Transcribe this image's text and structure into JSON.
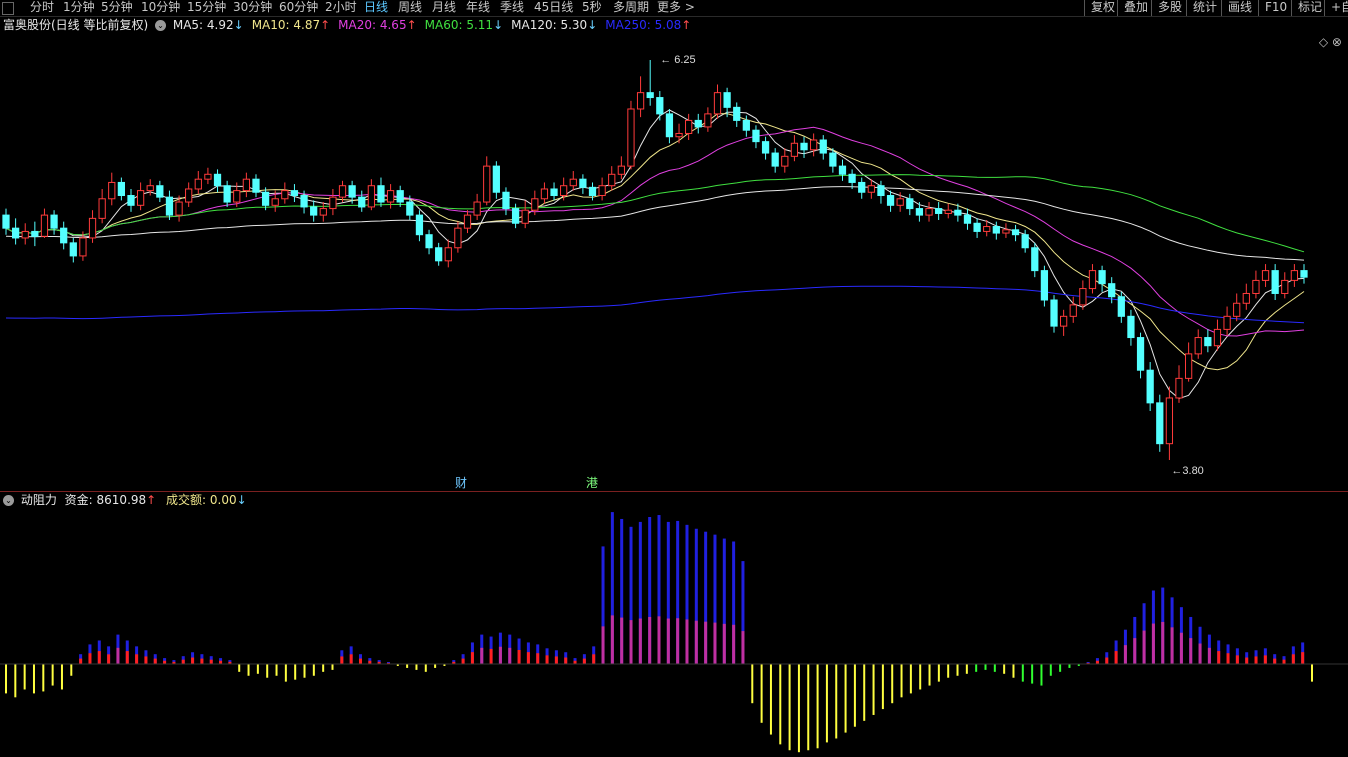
{
  "toolbar": {
    "tabs": [
      "分时",
      "1分钟",
      "5分钟",
      "10分钟",
      "15分钟",
      "30分钟",
      "60分钟",
      "2小时",
      "日线",
      "周线",
      "月线",
      "年线",
      "季线",
      "45日线",
      "5秒",
      "多周期",
      "更多 >"
    ],
    "active_tab": "日线",
    "right_tabs": [
      "复权",
      "叠加",
      "多股",
      "统计",
      "画线",
      "F10",
      "标记",
      "+自"
    ]
  },
  "info": {
    "stock": "富奥股份(日线 等比前复权)",
    "ma": [
      {
        "label": "MA5: 4.92",
        "arrow": "↓",
        "color": "#e6e6e6"
      },
      {
        "label": "MA10: 4.87",
        "arrow": "↑",
        "color": "#f0e68c"
      },
      {
        "label": "MA20: 4.65",
        "arrow": "↑",
        "color": "#e040e0"
      },
      {
        "label": "MA60: 5.11",
        "arrow": "↓",
        "color": "#40e040"
      },
      {
        "label": "MA120: 5.30",
        "arrow": "↓",
        "color": "#e6e6e6"
      },
      {
        "label": "MA250: 5.08",
        "arrow": "↑",
        "color": "#2a2aff"
      }
    ],
    "right_icons": "◇ ⊗"
  },
  "annotations": {
    "high": "6.25",
    "low": "3.80",
    "event_cai": "财",
    "event_gang": "港"
  },
  "sub_info": {
    "name": "动阻力",
    "fund_label": "资金: 8610.98",
    "fund_arrow": "↑",
    "volume_label": "成交额: 0.00",
    "volume_arrow": "↓"
  },
  "colors": {
    "up": "#ff3b3b",
    "down": "#54ffff",
    "ma5": "#e6e6e6",
    "ma10": "#f0e68c",
    "ma20": "#e040e0",
    "ma60": "#40e040",
    "ma120": "#e6e6e6",
    "ma250": "#2a2aff",
    "pos_fund": "#2020e0",
    "pos_red": "#ff2020",
    "pos_purple": "#c030a0",
    "neg_yellow": "#ffff40",
    "neg_green": "#30ff30"
  },
  "chart_data": {
    "type": "candlestick",
    "title": "富奥股份(日线 等比前复权)",
    "price_range": [
      3.8,
      6.25
    ],
    "candles": [
      [
        5.3,
        5.22,
        5.34,
        5.18
      ],
      [
        5.22,
        5.16,
        5.28,
        5.12
      ],
      [
        5.16,
        5.2,
        5.25,
        5.12
      ],
      [
        5.2,
        5.17,
        5.26,
        5.11
      ],
      [
        5.17,
        5.3,
        5.34,
        5.16
      ],
      [
        5.3,
        5.22,
        5.33,
        5.18
      ],
      [
        5.22,
        5.13,
        5.26,
        5.09
      ],
      [
        5.13,
        5.05,
        5.16,
        5.01
      ],
      [
        5.05,
        5.16,
        5.2,
        5.02
      ],
      [
        5.16,
        5.28,
        5.33,
        5.13
      ],
      [
        5.28,
        5.4,
        5.46,
        5.25
      ],
      [
        5.4,
        5.5,
        5.56,
        5.36
      ],
      [
        5.5,
        5.42,
        5.53,
        5.39
      ],
      [
        5.42,
        5.36,
        5.46,
        5.32
      ],
      [
        5.36,
        5.45,
        5.5,
        5.33
      ],
      [
        5.45,
        5.48,
        5.52,
        5.42
      ],
      [
        5.48,
        5.41,
        5.51,
        5.38
      ],
      [
        5.41,
        5.3,
        5.45,
        5.27
      ],
      [
        5.3,
        5.38,
        5.42,
        5.26
      ],
      [
        5.38,
        5.46,
        5.5,
        5.35
      ],
      [
        5.46,
        5.52,
        5.57,
        5.43
      ],
      [
        5.52,
        5.55,
        5.59,
        5.49
      ],
      [
        5.55,
        5.48,
        5.58,
        5.44
      ],
      [
        5.48,
        5.38,
        5.51,
        5.35
      ],
      [
        5.38,
        5.45,
        5.5,
        5.35
      ],
      [
        5.45,
        5.52,
        5.56,
        5.41
      ],
      [
        5.52,
        5.44,
        5.55,
        5.41
      ],
      [
        5.44,
        5.36,
        5.47,
        5.33
      ],
      [
        5.36,
        5.4,
        5.45,
        5.32
      ],
      [
        5.4,
        5.45,
        5.5,
        5.37
      ],
      [
        5.45,
        5.42,
        5.49,
        5.38
      ],
      [
        5.42,
        5.35,
        5.45,
        5.31
      ],
      [
        5.35,
        5.3,
        5.39,
        5.26
      ],
      [
        5.3,
        5.34,
        5.38,
        5.26
      ],
      [
        5.34,
        5.41,
        5.46,
        5.3
      ],
      [
        5.41,
        5.48,
        5.51,
        5.38
      ],
      [
        5.48,
        5.41,
        5.51,
        5.37
      ],
      [
        5.41,
        5.35,
        5.45,
        5.32
      ],
      [
        5.35,
        5.48,
        5.52,
        5.33
      ],
      [
        5.48,
        5.38,
        5.53,
        5.35
      ],
      [
        5.38,
        5.45,
        5.49,
        5.34
      ],
      [
        5.45,
        5.38,
        5.48,
        5.35
      ],
      [
        5.38,
        5.3,
        5.42,
        5.27
      ],
      [
        5.3,
        5.18,
        5.33,
        5.14
      ],
      [
        5.18,
        5.1,
        5.21,
        5.06
      ],
      [
        5.1,
        5.02,
        5.13,
        4.99
      ],
      [
        5.02,
        5.1,
        5.15,
        4.98
      ],
      [
        5.1,
        5.22,
        5.26,
        5.07
      ],
      [
        5.22,
        5.3,
        5.33,
        5.19
      ],
      [
        5.3,
        5.38,
        5.43,
        5.27
      ],
      [
        5.38,
        5.6,
        5.66,
        5.36
      ],
      [
        5.6,
        5.44,
        5.63,
        5.4
      ],
      [
        5.44,
        5.34,
        5.47,
        5.3
      ],
      [
        5.34,
        5.25,
        5.37,
        5.22
      ],
      [
        5.25,
        5.33,
        5.39,
        5.22
      ],
      [
        5.33,
        5.4,
        5.45,
        5.3
      ],
      [
        5.4,
        5.46,
        5.5,
        5.37
      ],
      [
        5.46,
        5.42,
        5.5,
        5.39
      ],
      [
        5.42,
        5.48,
        5.53,
        5.39
      ],
      [
        5.48,
        5.52,
        5.57,
        5.45
      ],
      [
        5.52,
        5.47,
        5.55,
        5.43
      ],
      [
        5.47,
        5.42,
        5.5,
        5.39
      ],
      [
        5.42,
        5.48,
        5.53,
        5.39
      ],
      [
        5.48,
        5.55,
        5.6,
        5.45
      ],
      [
        5.55,
        5.6,
        5.66,
        5.52
      ],
      [
        5.6,
        5.95,
        6.0,
        5.58
      ],
      [
        5.95,
        6.05,
        6.15,
        5.9
      ],
      [
        6.05,
        6.02,
        6.25,
        5.97
      ],
      [
        6.02,
        5.92,
        6.06,
        5.88
      ],
      [
        5.92,
        5.78,
        5.95,
        5.74
      ],
      [
        5.78,
        5.8,
        5.86,
        5.74
      ],
      [
        5.8,
        5.88,
        5.92,
        5.76
      ],
      [
        5.88,
        5.84,
        5.92,
        5.8
      ],
      [
        5.84,
        5.92,
        5.96,
        5.81
      ],
      [
        5.92,
        6.05,
        6.1,
        5.89
      ],
      [
        6.05,
        5.96,
        6.08,
        5.9
      ],
      [
        5.96,
        5.88,
        5.99,
        5.84
      ],
      [
        5.88,
        5.82,
        5.91,
        5.78
      ],
      [
        5.82,
        5.75,
        5.85,
        5.71
      ],
      [
        5.75,
        5.68,
        5.78,
        5.64
      ],
      [
        5.68,
        5.6,
        5.71,
        5.56
      ],
      [
        5.6,
        5.66,
        5.71,
        5.56
      ],
      [
        5.66,
        5.74,
        5.79,
        5.63
      ],
      [
        5.74,
        5.7,
        5.78,
        5.65
      ],
      [
        5.7,
        5.76,
        5.8,
        5.66
      ],
      [
        5.76,
        5.68,
        5.79,
        5.64
      ],
      [
        5.68,
        5.6,
        5.71,
        5.56
      ],
      [
        5.6,
        5.55,
        5.64,
        5.51
      ],
      [
        5.55,
        5.5,
        5.58,
        5.46
      ],
      [
        5.5,
        5.44,
        5.53,
        5.4
      ],
      [
        5.44,
        5.48,
        5.52,
        5.4
      ],
      [
        5.48,
        5.42,
        5.51,
        5.37
      ],
      [
        5.42,
        5.36,
        5.45,
        5.32
      ],
      [
        5.36,
        5.4,
        5.44,
        5.32
      ],
      [
        5.4,
        5.34,
        5.43,
        5.3
      ],
      [
        5.34,
        5.3,
        5.38,
        5.26
      ],
      [
        5.3,
        5.34,
        5.38,
        5.26
      ],
      [
        5.34,
        5.31,
        5.38,
        5.27
      ],
      [
        5.31,
        5.33,
        5.37,
        5.28
      ],
      [
        5.33,
        5.3,
        5.37,
        5.26
      ],
      [
        5.3,
        5.25,
        5.34,
        5.21
      ],
      [
        5.25,
        5.2,
        5.28,
        5.16
      ],
      [
        5.2,
        5.23,
        5.27,
        5.17
      ],
      [
        5.23,
        5.19,
        5.26,
        5.15
      ],
      [
        5.19,
        5.21,
        5.25,
        5.16
      ],
      [
        5.21,
        5.18,
        5.24,
        5.14
      ],
      [
        5.18,
        5.1,
        5.21,
        5.07
      ],
      [
        5.1,
        4.96,
        5.13,
        4.92
      ],
      [
        4.96,
        4.78,
        4.99,
        4.74
      ],
      [
        4.78,
        4.62,
        4.81,
        4.58
      ],
      [
        4.62,
        4.68,
        4.72,
        4.56
      ],
      [
        4.68,
        4.75,
        4.8,
        4.64
      ],
      [
        4.75,
        4.85,
        4.9,
        4.72
      ],
      [
        4.85,
        4.96,
        5.0,
        4.82
      ],
      [
        4.96,
        4.88,
        4.99,
        4.83
      ],
      [
        4.88,
        4.8,
        4.92,
        4.76
      ],
      [
        4.8,
        4.68,
        4.83,
        4.64
      ],
      [
        4.68,
        4.55,
        4.72,
        4.5
      ],
      [
        4.55,
        4.35,
        4.58,
        4.3
      ],
      [
        4.35,
        4.15,
        4.4,
        4.1
      ],
      [
        4.15,
        3.9,
        4.2,
        3.85
      ],
      [
        3.9,
        4.18,
        4.25,
        3.8
      ],
      [
        4.18,
        4.3,
        4.38,
        4.15
      ],
      [
        4.3,
        4.45,
        4.52,
        4.28
      ],
      [
        4.45,
        4.55,
        4.6,
        4.42
      ],
      [
        4.55,
        4.5,
        4.6,
        4.46
      ],
      [
        4.5,
        4.6,
        4.66,
        4.47
      ],
      [
        4.6,
        4.68,
        4.74,
        4.56
      ],
      [
        4.68,
        4.76,
        4.82,
        4.65
      ],
      [
        4.76,
        4.82,
        4.88,
        4.72
      ],
      [
        4.82,
        4.9,
        4.96,
        4.79
      ],
      [
        4.9,
        4.96,
        5.0,
        4.86
      ],
      [
        4.96,
        4.82,
        5.0,
        4.78
      ],
      [
        4.82,
        4.9,
        4.95,
        4.79
      ],
      [
        4.9,
        4.96,
        5.0,
        4.86
      ],
      [
        4.96,
        4.92,
        5.0,
        4.88
      ]
    ],
    "ma_series": [
      "MA5",
      "MA10",
      "MA20",
      "MA60",
      "MA120",
      "MA250"
    ],
    "indicator": {
      "name": "动阻力",
      "fund": 8610.98,
      "volume": 0.0,
      "values": [
        -30,
        -34,
        -26,
        -30,
        -28,
        -22,
        -26,
        -12,
        10,
        20,
        24,
        18,
        30,
        24,
        18,
        14,
        10,
        6,
        4,
        8,
        12,
        10,
        8,
        6,
        4,
        -8,
        -12,
        -10,
        -14,
        -12,
        -18,
        -16,
        -14,
        -12,
        -8,
        -6,
        14,
        18,
        10,
        6,
        4,
        2,
        -2,
        -4,
        -6,
        -8,
        -4,
        -2,
        4,
        10,
        22,
        30,
        28,
        32,
        30,
        26,
        22,
        20,
        16,
        14,
        12,
        6,
        10,
        18,
        120,
        155,
        148,
        140,
        145,
        150,
        152,
        145,
        146,
        142,
        138,
        135,
        132,
        128,
        125,
        105,
        -40,
        -60,
        -72,
        -82,
        -88,
        -90,
        -88,
        -86,
        -80,
        -76,
        -70,
        -64,
        -58,
        -52,
        -46,
        -40,
        -34,
        -30,
        -26,
        -22,
        -18,
        -14,
        -12,
        -10,
        -8,
        -6,
        -8,
        -10,
        -14,
        -18,
        -20,
        -22,
        -12,
        -8,
        -4,
        -2,
        2,
        6,
        12,
        24,
        35,
        48,
        62,
        75,
        78,
        68,
        58,
        48,
        38,
        30,
        24,
        20,
        16,
        12,
        14,
        16,
        10,
        8,
        18,
        22,
        -18
      ]
    }
  }
}
